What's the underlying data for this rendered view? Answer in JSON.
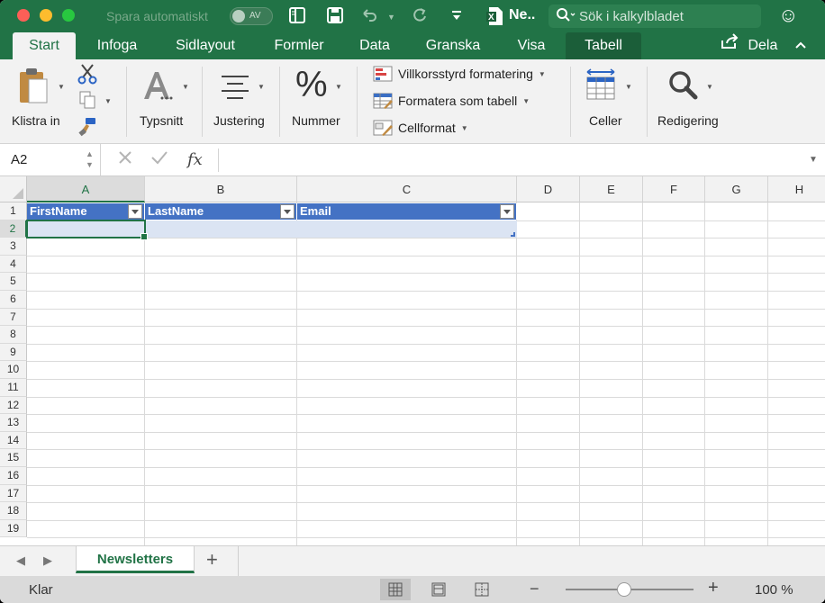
{
  "titlebar": {
    "autosave_label": "Spara automatiskt",
    "autosave_state": "AV",
    "doc_title": "Ne..",
    "search_placeholder": "Sök i kalkylbladet"
  },
  "tabs": [
    "Start",
    "Infoga",
    "Sidlayout",
    "Formler",
    "Data",
    "Granska",
    "Visa",
    "Tabell"
  ],
  "active_tab": "Start",
  "share_label": "Dela",
  "ribbon": {
    "paste": "Klistra in",
    "font": "Typsnitt",
    "alignment": "Justering",
    "number": "Nummer",
    "conditional_formatting": "Villkorsstyrd formatering",
    "format_as_table": "Formatera som tabell",
    "cell_styles": "Cellformat",
    "cells": "Celler",
    "editing": "Redigering"
  },
  "formula_bar": {
    "name_box": "A2",
    "fx": "fx",
    "content": ""
  },
  "grid": {
    "columns": [
      "A",
      "B",
      "C",
      "D",
      "E",
      "F",
      "G",
      "H"
    ],
    "rows": [
      "1",
      "2",
      "3",
      "4",
      "5",
      "6",
      "7",
      "8",
      "9",
      "10",
      "11",
      "12",
      "13",
      "14",
      "15",
      "16",
      "17",
      "18",
      "19"
    ],
    "table_headers": [
      "FirstName",
      "LastName",
      "Email"
    ],
    "selected_cell": "A2"
  },
  "sheets": [
    "Newsletters"
  ],
  "status": {
    "text": "Klar",
    "zoom": "100 %"
  },
  "colors": {
    "brand": "#217346",
    "table_header": "#4472c4",
    "table_row": "#dbe4f3"
  }
}
